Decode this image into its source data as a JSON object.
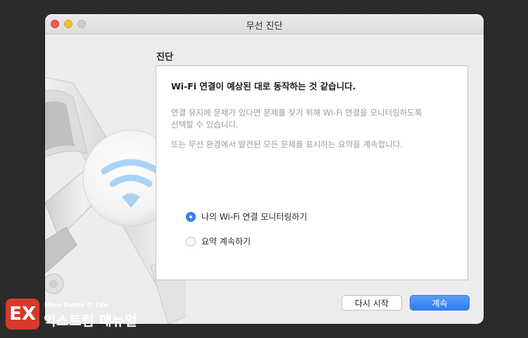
{
  "window": {
    "title": "무선 진단"
  },
  "section": {
    "title": "진단"
  },
  "content": {
    "headline": "Wi-Fi 연결이 예상된 대로 동작하는 것 같습니다.",
    "desc1_line1": "연결 유지에 문제가 있다면 문제를 찾기 위해 Wi-Fi 연결을 모니터링하도록",
    "desc1_line2": "선택할 수 있습니다.",
    "desc2": "또는 무선 환경에서 발견된 모든 문제를 표시하는 요약을 계속합니다."
  },
  "options": [
    {
      "label": "나의 Wi-Fi 연결 모니터링하기",
      "selected": true
    },
    {
      "label": "요약 계속하기",
      "selected": false
    }
  ],
  "buttons": {
    "restart": "다시 시작",
    "continue": "계속"
  },
  "brand": {
    "logo_text": "EX",
    "tagline": "More Better IT Life",
    "name": "익스트림 매뉴얼"
  },
  "colors": {
    "accent": "#3b82f6",
    "brand": "#d73a2b",
    "wifi": "#9ecdf2"
  }
}
